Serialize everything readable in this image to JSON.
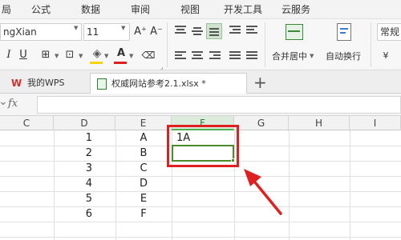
{
  "menu": {
    "items": [
      "局",
      "公式",
      "数据",
      "审阅",
      "视图",
      "开发工具",
      "云服务"
    ]
  },
  "toolbar": {
    "font_name": "ngXian",
    "font_size": "11",
    "bold": "B",
    "italic": "I",
    "underline": "U",
    "font_color_glyph": "A",
    "merge_label": "合并居中",
    "wrap_label": "自动换行",
    "format_label": "常规",
    "grow_font": "A⁺",
    "shrink_font": "A⁻"
  },
  "tabs": [
    {
      "label": "我的WPS"
    },
    {
      "label": "权威网站参考2.1.xlsx *"
    }
  ],
  "add_tab_label": "+",
  "formula_bar": {
    "fx_label": "fx",
    "value": ""
  },
  "columns": [
    "C",
    "D",
    "E",
    "F",
    "G",
    "H",
    "I"
  ],
  "cells": {
    "D": [
      "1",
      "2",
      "3",
      "4",
      "5",
      "6"
    ],
    "E": [
      "A",
      "B",
      "C",
      "D",
      "E",
      "F"
    ],
    "F1": "1A"
  },
  "colors": {
    "accent": "#4a8a2a",
    "highlight": "#e02020",
    "active_header": "#dcebdc"
  }
}
